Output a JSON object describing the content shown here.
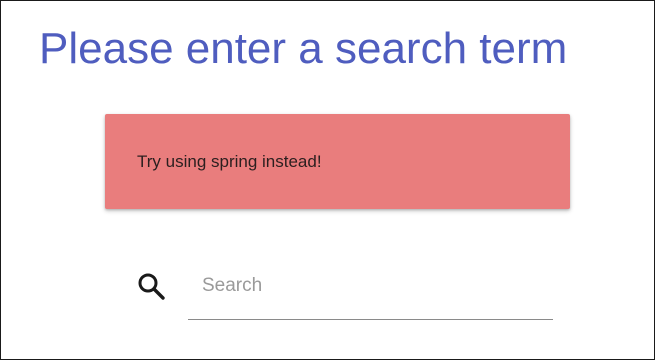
{
  "page": {
    "title": "Please enter a search term"
  },
  "alert": {
    "message": "Try using spring instead!",
    "background_color": "#e97d7d"
  },
  "search": {
    "icon": "search-icon",
    "placeholder": "Search",
    "value": ""
  },
  "colors": {
    "title": "#4f5dbf",
    "alert": "#e97d7d",
    "underline": "#8a8a8a"
  }
}
